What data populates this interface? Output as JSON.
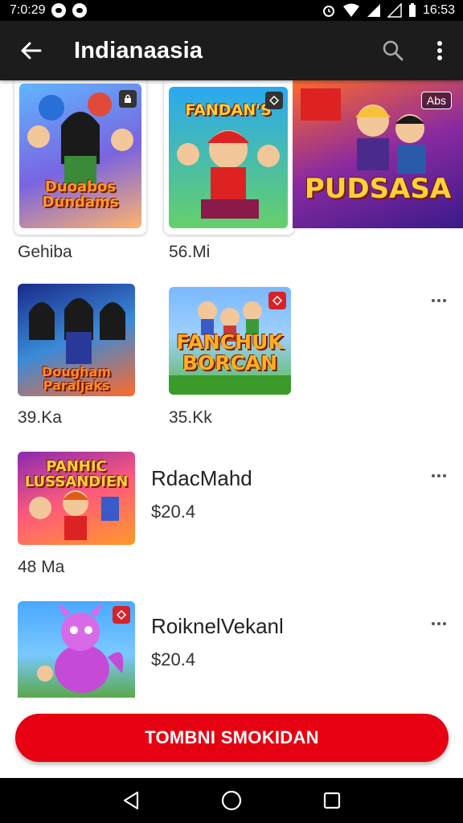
{
  "status_bar": {
    "time_left": "7:0:29",
    "time_right": "16:53"
  },
  "app_bar": {
    "title": "Indianaasia"
  },
  "items": [
    {
      "art_text": "Duoabos Dundams",
      "size": "Gehiba"
    },
    {
      "art_text": "FANDAN'S",
      "size": "56.Mi"
    },
    {
      "art_text": "PUDSASA",
      "badge": "Abs"
    },
    {
      "art_text": "Dougham Paraljaks",
      "size": "39.Ka"
    },
    {
      "art_text": "FANCHUK BORCAN",
      "size": "35.Kk"
    },
    {
      "art_text": "PANHIC LUSSANDIEN",
      "size": "48 Ma",
      "title": "RdacMahd",
      "price": "$20.4"
    },
    {
      "title": "RoiknelVekanl",
      "price": "$20.4"
    }
  ],
  "cta": {
    "label": "TOMBNI SMOKIDAN"
  },
  "colors": {
    "accent": "#e60012",
    "app_bar": "#1c1c1c"
  }
}
